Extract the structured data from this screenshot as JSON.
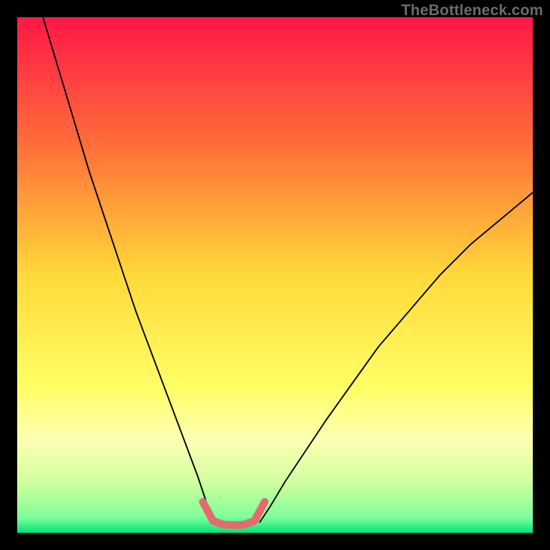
{
  "watermark": {
    "text": "TheBottleneck.com"
  },
  "chart_data": {
    "type": "line",
    "title": "",
    "xlabel": "",
    "ylabel": "",
    "xlim": [
      0,
      100
    ],
    "ylim": [
      0,
      100
    ],
    "background": {
      "type": "vertical-gradient",
      "stops": [
        {
          "offset": 0,
          "color": "#ff1747"
        },
        {
          "offset": 25,
          "color": "#ff6f3a"
        },
        {
          "offset": 50,
          "color": "#ffd93a"
        },
        {
          "offset": 72,
          "color": "#ffff66"
        },
        {
          "offset": 82,
          "color": "#fdffb3"
        },
        {
          "offset": 90,
          "color": "#d2ff9e"
        },
        {
          "offset": 97,
          "color": "#7dff9a"
        },
        {
          "offset": 100,
          "color": "#00e37a"
        }
      ]
    },
    "series": [
      {
        "name": "left-branch",
        "color": "#000000",
        "width": 2,
        "x": [
          5,
          8,
          11,
          14,
          17,
          20,
          23,
          26,
          29,
          32,
          35,
          37,
          38.5
        ],
        "y": [
          100,
          90,
          80,
          70,
          61,
          52,
          43,
          35,
          27,
          19,
          11,
          5,
          2
        ]
      },
      {
        "name": "right-branch",
        "color": "#000000",
        "width": 2,
        "x": [
          47,
          49,
          52,
          56,
          60,
          65,
          70,
          76,
          82,
          88,
          94,
          100
        ],
        "y": [
          2,
          5,
          10,
          16,
          22,
          29,
          36,
          43,
          50,
          56,
          61,
          66
        ]
      },
      {
        "name": "valley-highlight",
        "color": "#e46a6f",
        "width": 11,
        "linecap": "round",
        "x": [
          36,
          38,
          40,
          42,
          44,
          46,
          48
        ],
        "y": [
          6,
          2.3,
          1.6,
          1.5,
          1.6,
          2.3,
          6
        ]
      }
    ]
  }
}
